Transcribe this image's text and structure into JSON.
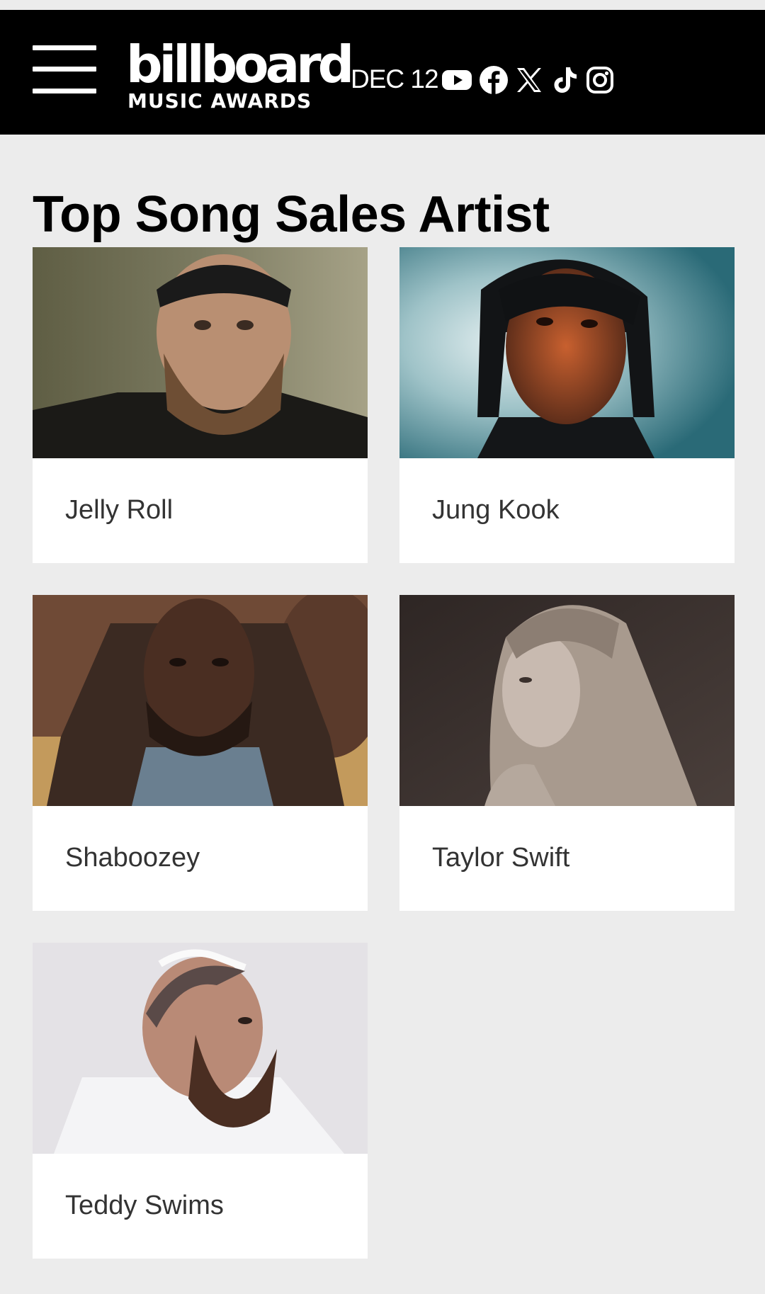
{
  "header": {
    "menu_label": "Menu",
    "logo_word": "billboard",
    "logo_sub": "MUSIC AWARDS",
    "date": "DEC 12",
    "social": [
      "youtube-icon",
      "facebook-icon",
      "x-icon",
      "tiktok-icon",
      "instagram-icon"
    ],
    "colors": {
      "background": "#000000",
      "text": "#ffffff"
    }
  },
  "page": {
    "title": "Top Song Sales Artist",
    "background": "#ececec"
  },
  "artists": [
    {
      "name": "Jelly Roll"
    },
    {
      "name": "Jung Kook"
    },
    {
      "name": "Shaboozey"
    },
    {
      "name": "Taylor Swift"
    },
    {
      "name": "Teddy Swims"
    }
  ]
}
